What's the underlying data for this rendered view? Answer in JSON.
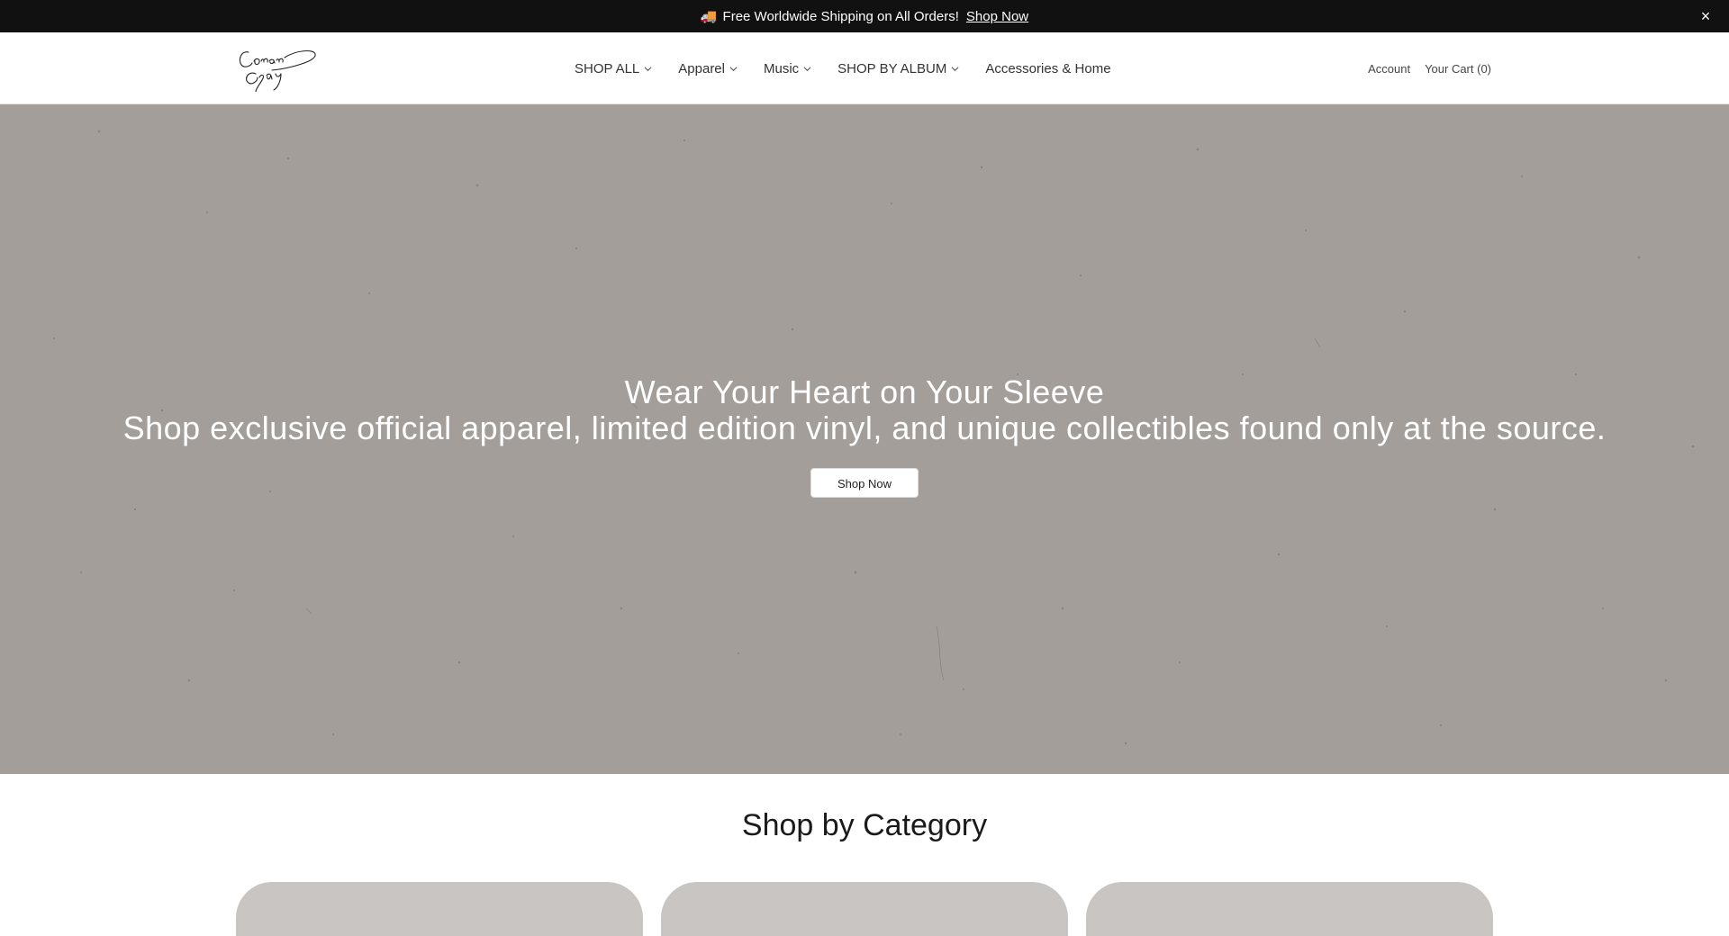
{
  "announcement": {
    "icon": "truck-icon",
    "emoji": "🚚",
    "message": "Free Worldwide Shipping on All Orders!",
    "link_label": "Shop Now",
    "close_symbol": "×"
  },
  "header": {
    "logo_text": "Conan Gray",
    "nav": [
      {
        "label": "SHOP ALL",
        "dropdown": true
      },
      {
        "label": "Apparel",
        "dropdown": true
      },
      {
        "label": "Music",
        "dropdown": true
      },
      {
        "label": "SHOP BY ALBUM",
        "dropdown": true
      },
      {
        "label": "Accessories & Home",
        "dropdown": false
      }
    ],
    "account_label": "Account",
    "cart_label": "Your Cart (0)"
  },
  "hero": {
    "title": "Wear Your Heart on Your Sleeve",
    "subtitle": "Shop exclusive official apparel, limited edition vinyl, and unique collectibles found only at the source.",
    "button_label": "Shop Now",
    "background_color": "#a39e99"
  },
  "category_section": {
    "title": "Shop by Category",
    "card_count": 3
  },
  "colors": {
    "announcement_bg": "#111111",
    "hero_bg": "#a39e99",
    "category_card_bg": "#c8c5c2"
  }
}
